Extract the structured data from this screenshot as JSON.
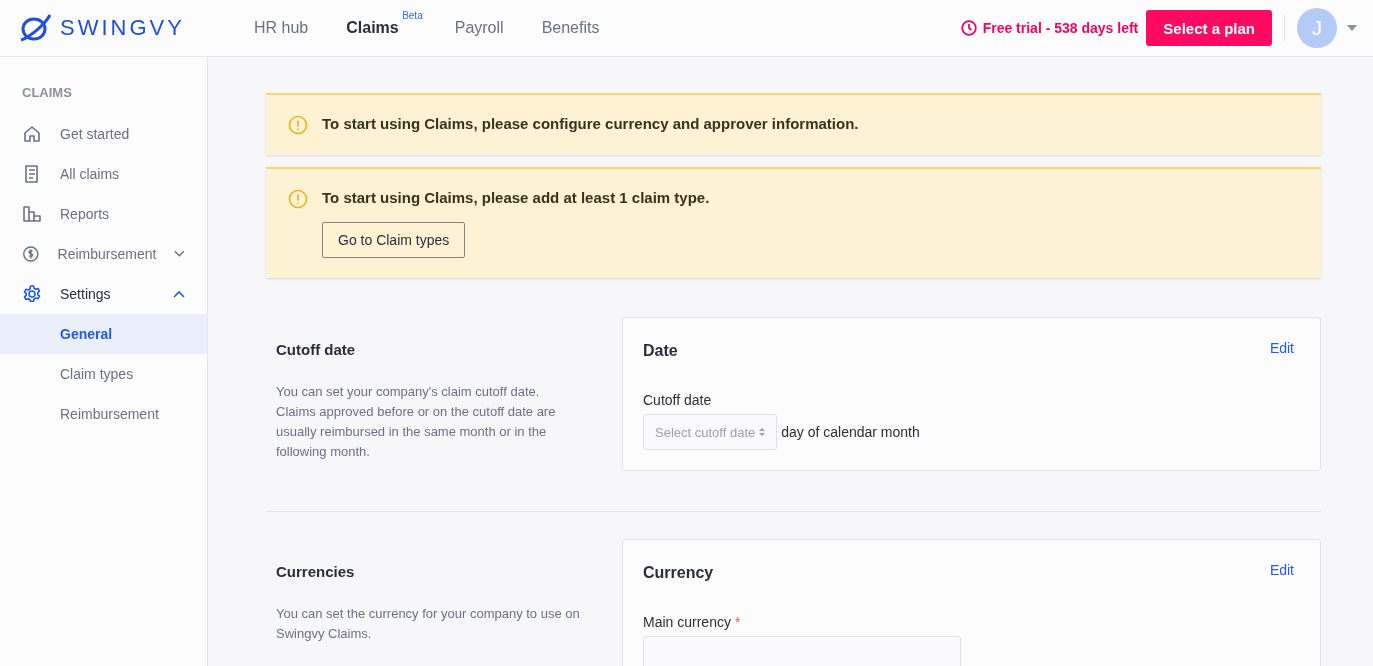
{
  "header": {
    "logo": "SWINGVY",
    "nav": [
      {
        "label": "HR hub",
        "selected": false
      },
      {
        "label": "Claims",
        "selected": true,
        "badge": "Beta"
      },
      {
        "label": "Payroll",
        "selected": false
      },
      {
        "label": "Benefits",
        "selected": false
      }
    ],
    "trial": "Free trial - 538 days left",
    "plan_button": "Select a plan",
    "avatar": "J"
  },
  "sidebar": {
    "heading": "CLAIMS",
    "items": [
      {
        "label": "Get started",
        "kind": "link",
        "selected": false
      },
      {
        "label": "All claims",
        "kind": "link",
        "selected": false
      },
      {
        "label": "Reports",
        "kind": "link",
        "selected": false
      },
      {
        "label": "Reimbursement",
        "kind": "group",
        "selected": false,
        "expanded": false
      },
      {
        "label": "Settings",
        "kind": "group",
        "selected": true,
        "expanded": true,
        "children": [
          {
            "label": "General",
            "selected": true
          },
          {
            "label": "Claim types",
            "selected": false
          },
          {
            "label": "Reimbursement",
            "selected": false
          }
        ]
      }
    ]
  },
  "alerts": [
    {
      "text": "To start using Claims, please configure currency and approver information."
    },
    {
      "text": "To start using Claims, please add at least 1 claim type.",
      "button": "Go to Claim types"
    }
  ],
  "sections": [
    {
      "title": "Cutoff date",
      "description": "You can set your company's claim cutoff date. Claims approved before or on the cutoff date are usually reimbursed in the same month or in the following month.",
      "card": {
        "title": "Date",
        "edit": "Edit",
        "field": {
          "label": "Cutoff date",
          "placeholder": "Select cutoff date",
          "suffix": "day of calendar month"
        }
      }
    },
    {
      "title": "Currencies",
      "description": "You can set the currency for your company to use on Swingvy Claims.",
      "card": {
        "title": "Currency",
        "edit": "Edit",
        "field": {
          "label": "Main currency",
          "required_mark": "*"
        }
      }
    }
  ]
}
